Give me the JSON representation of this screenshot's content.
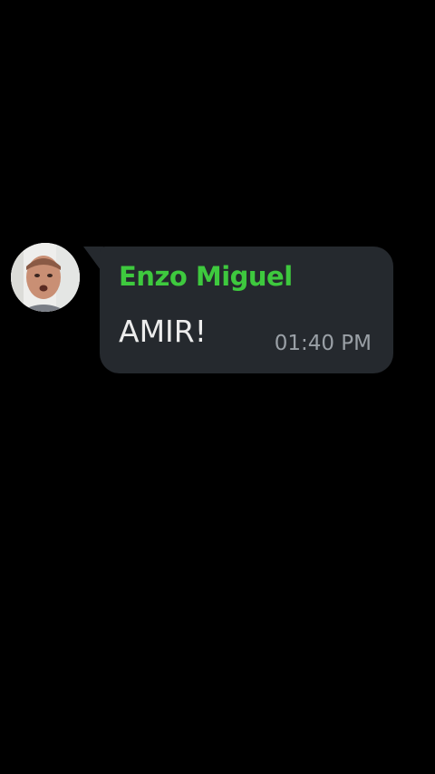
{
  "message": {
    "sender_name": "Enzo Miguel",
    "sender_color": "#3ec93e",
    "text": "AMIR!",
    "time": "01:40 PM",
    "bubble_color": "#25292e"
  },
  "avatar": {
    "icon": "user-photo-avatar"
  },
  "screen": {
    "background": "#000000"
  }
}
